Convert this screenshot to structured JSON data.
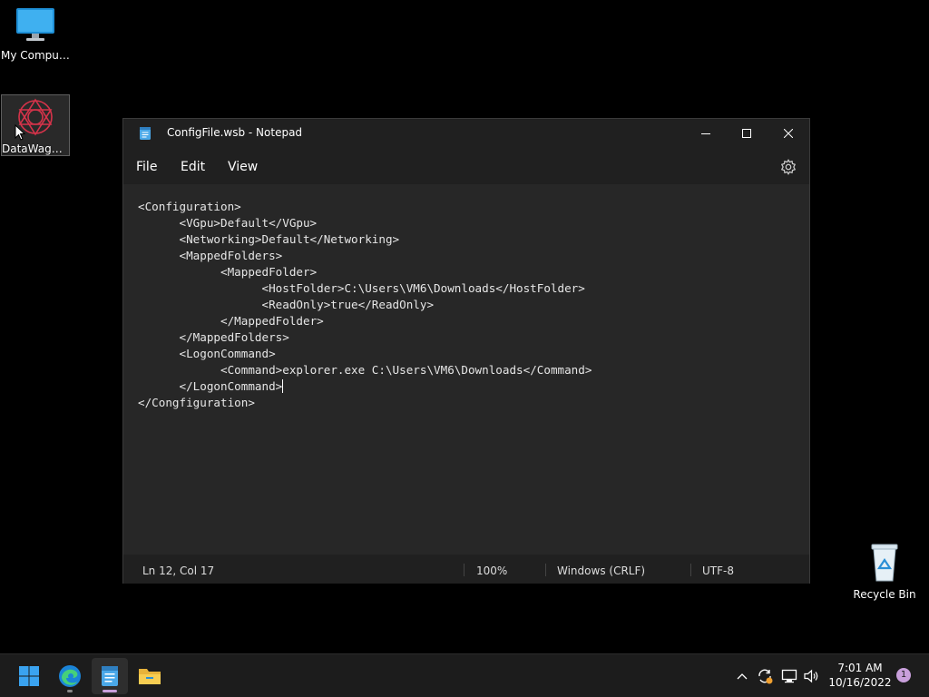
{
  "desktop": {
    "icons": [
      {
        "label": "My Computer"
      },
      {
        "label": "DataWagon..."
      },
      {
        "label": "Recycle Bin"
      }
    ]
  },
  "window": {
    "title": "ConfigFile.wsb - Notepad",
    "menu": {
      "file": "File",
      "edit": "Edit",
      "view": "View"
    },
    "content": "<Configuration>\n\t<VGpu>Default</VGpu>\n\t<Networking>Default</Networking>\n\t<MappedFolders>\n\t\t<MappedFolder>\n\t\t\t<HostFolder>C:\\Users\\VM6\\Downloads</HostFolder>\n\t\t\t<ReadOnly>true</ReadOnly>\n\t\t</MappedFolder>\n\t</MappedFolders>\n\t<LogonCommand>\n\t\t<Command>explorer.exe C:\\Users\\VM6\\Downloads</Command>\n\t</LogonCommand>",
    "content_tail": "\n</Congfiguration>",
    "status": {
      "position": "Ln 12, Col 17",
      "zoom": "100%",
      "line_ending": "Windows (CRLF)",
      "encoding": "UTF-8"
    }
  },
  "taskbar": {
    "apps": [
      "start-icon",
      "edge-icon",
      "notepad-icon",
      "file-explorer-icon"
    ],
    "tray": [
      "chevron-up-icon",
      "update-icon",
      "network-icon",
      "volume-icon"
    ],
    "time": "7:01 AM",
    "date": "10/16/2022",
    "notification_count": "1"
  },
  "colors": {
    "accent": "#c9a0dc",
    "window_bg": "#202020",
    "editor_bg": "#272727",
    "taskbar_bg": "#1c1c1c"
  }
}
